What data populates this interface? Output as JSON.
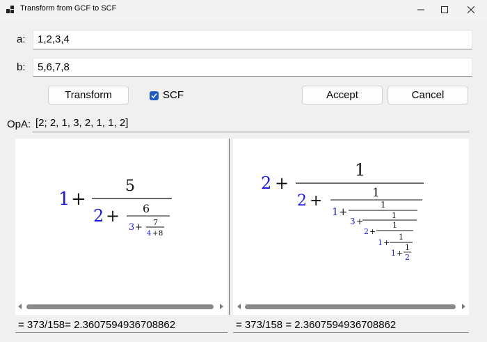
{
  "window": {
    "title": "Transform from GCF to SCF"
  },
  "form": {
    "a_label": "a:",
    "a_value": "1,2,3,4",
    "b_label": "b:",
    "b_value": "5,6,7,8"
  },
  "toolbar": {
    "transform_label": "Transform",
    "scf_label": "SCF",
    "scf_checked": true,
    "accept_label": "Accept",
    "cancel_label": "Cancel"
  },
  "opa": {
    "label": "OpA:",
    "value": "[2; 2, 1, 3, 2, 1, 1, 2]"
  },
  "left_panel": {
    "formula": {
      "a0": "1",
      "b1": "5",
      "a1": "2",
      "b2": "6",
      "a2": "3",
      "b3": "7",
      "a3": "4",
      "b4": "8",
      "plus": "+"
    },
    "result": "= 373/158= 2.3607594936708862"
  },
  "right_panel": {
    "formula": {
      "terms": [
        "2",
        "2",
        "1",
        "3",
        "2",
        "1",
        "1",
        "2"
      ],
      "one": "1",
      "plus": "+"
    },
    "result": "= 373/158 = 2.3607594936708862"
  },
  "colors": {
    "accent": "#1e5bc6",
    "formula_blue": "#1a1aee"
  }
}
